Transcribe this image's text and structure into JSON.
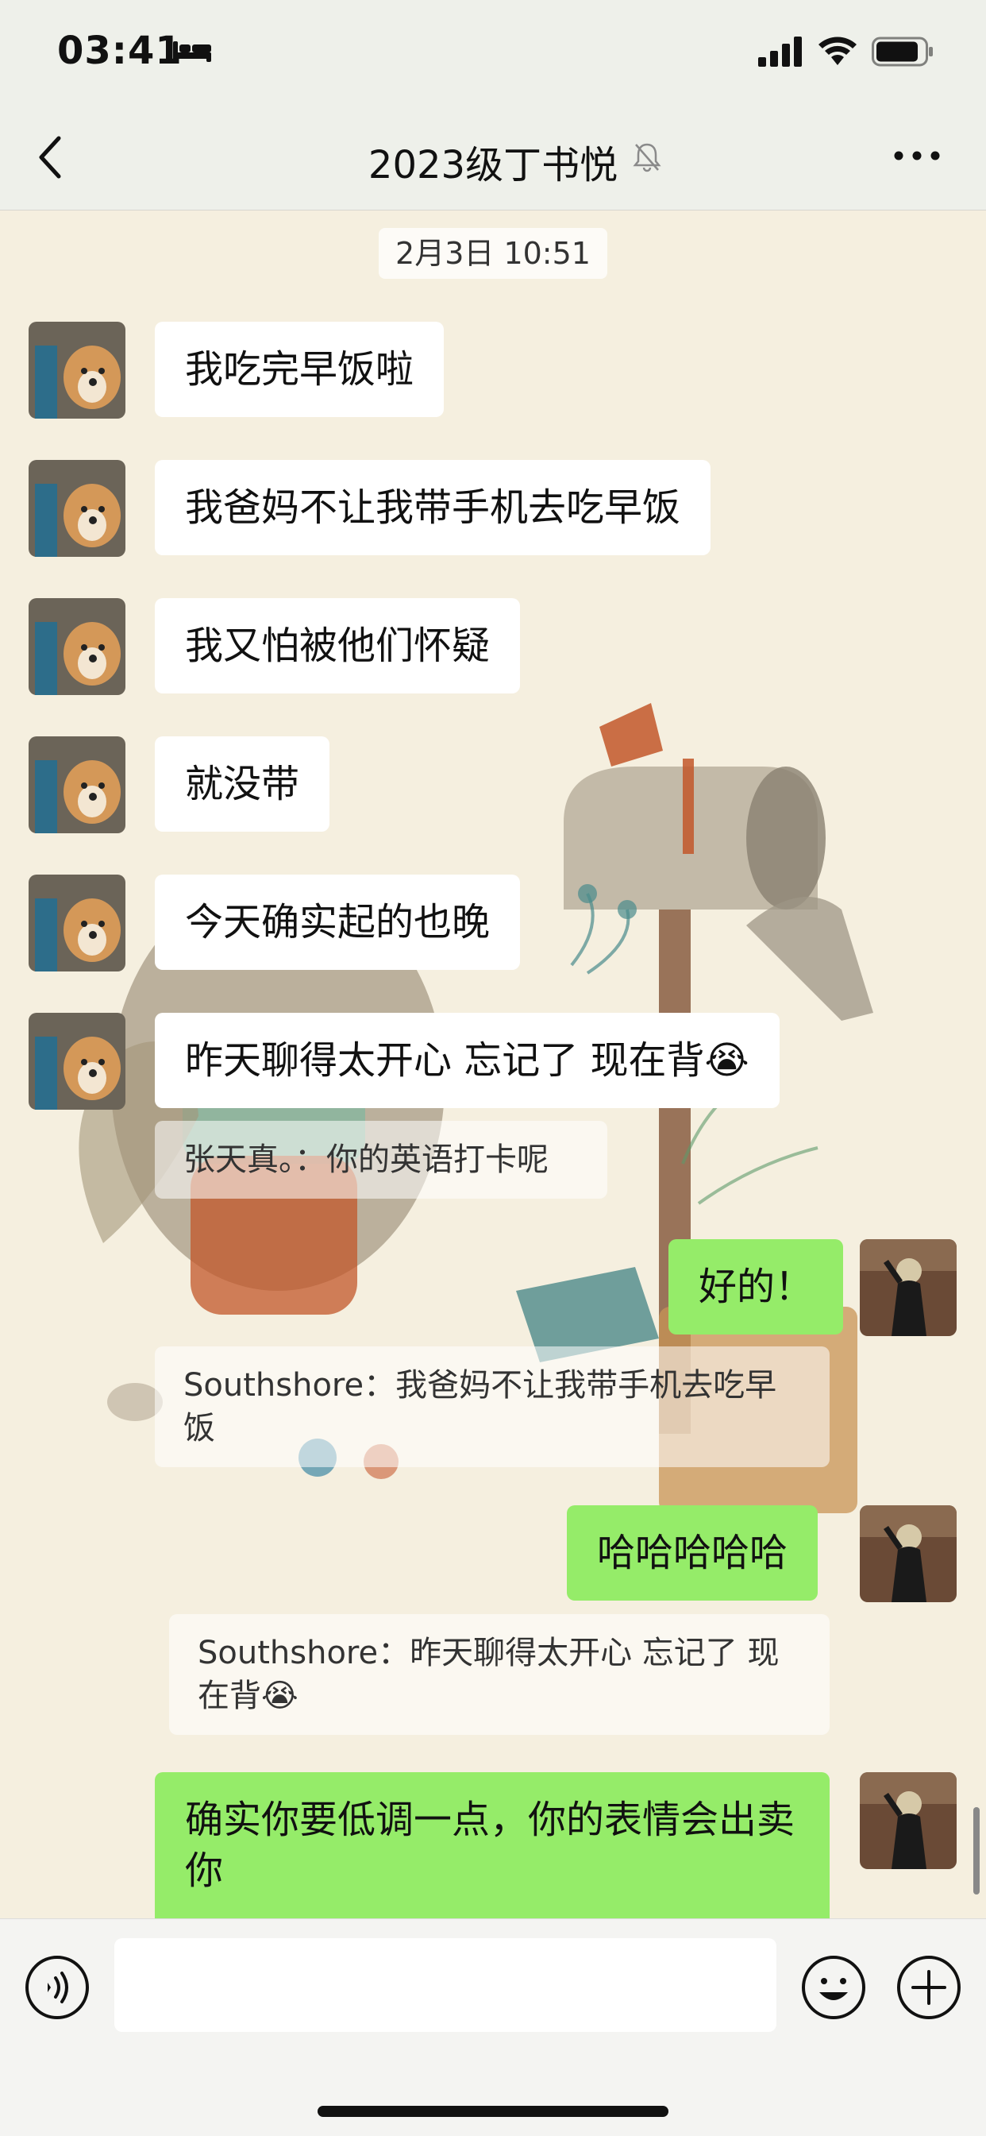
{
  "status_bar": {
    "time": "03:41"
  },
  "header": {
    "title": "2023级丁书悦"
  },
  "chat": {
    "timestamp": "2月3日 10:51",
    "messages": [
      {
        "text": "我吃完早饭啦"
      },
      {
        "text": "我爸妈不让我带手机去吃早饭"
      },
      {
        "text": "我又怕被他们怀疑"
      },
      {
        "text": "就没带"
      },
      {
        "text": "今天确实起的也晚"
      },
      {
        "text": "昨天聊得太开心 忘记了 现在背😭",
        "quote": "张天真。：你的英语打卡呢"
      },
      {
        "text": "好的！",
        "quote": "Southshore：我爸妈不让我带手机去吃早饭"
      },
      {
        "text": "哈哈哈哈哈",
        "quote": "Southshore：昨天聊得太开心 忘记了 现在背😭"
      },
      {
        "text": "确实你要低调一点，你的表情会出卖你"
      }
    ]
  },
  "input_bar": {
    "placeholder": ""
  }
}
